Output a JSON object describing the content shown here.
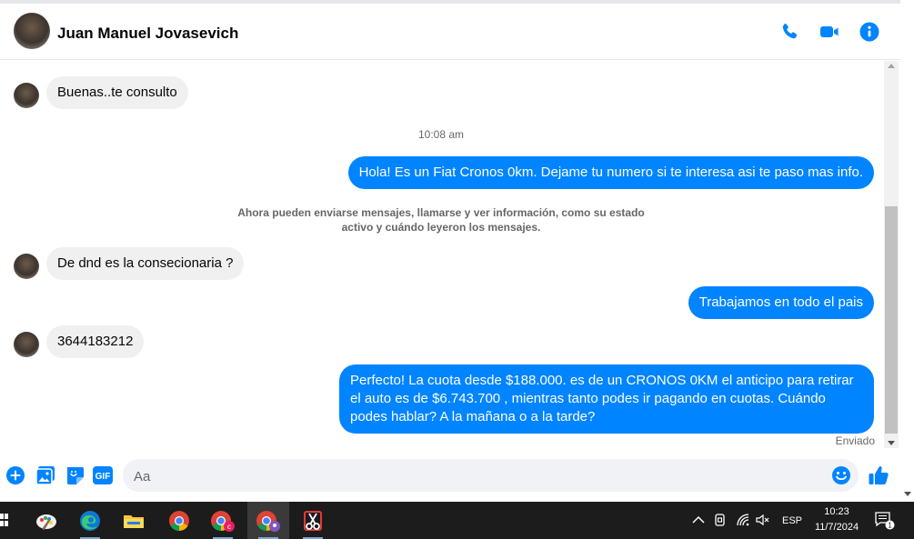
{
  "header": {
    "contact_name": "Juan Manuel Jovasevich",
    "icons": [
      "phone-icon",
      "video-call-icon",
      "info-icon"
    ]
  },
  "messages": [
    {
      "direction": "in",
      "text": "Buenas..te consulto"
    },
    {
      "type": "timestamp",
      "text": "10:08 am"
    },
    {
      "direction": "out",
      "text": "Hola! Es un Fiat Cronos 0km. Dejame tu numero si te interesa asi te paso mas info."
    },
    {
      "type": "system",
      "line1": "Ahora pueden enviarse mensajes, llamarse y ver información, como su estado",
      "line2": "activo y cuándo leyeron los mensajes."
    },
    {
      "direction": "in",
      "text": "De dnd es la consecionaria ?"
    },
    {
      "direction": "out",
      "text": "Trabajamos en todo el pais"
    },
    {
      "direction": "in",
      "text": "3644183212"
    },
    {
      "direction": "out",
      "text": "Perfecto! La cuota desde $188.000. es de un CRONOS 0KM el anticipo para retirar el auto es de $6.743.700 , mientras tanto podes ir pagando en cuotas. Cuándo podes hablar? A la mañana o a la tarde?"
    }
  ],
  "sent_status": "Enviado",
  "composer": {
    "placeholder": "Aa",
    "gif_label": "GIF",
    "icons": [
      "plus-icon",
      "photo-icon",
      "sticker-icon",
      "gif-icon",
      "emoji-icon",
      "like-icon"
    ]
  },
  "colors": {
    "accent": "#0084ff",
    "incoming_bubble": "#f0f0f0",
    "taskbar": "#1c1c1c"
  },
  "taskbar": {
    "apps": [
      "paint-icon",
      "edge-icon",
      "file-explorer-icon",
      "chrome-icon",
      "chrome-profile-c-icon",
      "chrome-profile-active-icon",
      "snipping-tool-icon"
    ],
    "language": "ESP",
    "time": "10:23",
    "date": "11/7/2024",
    "notification_count": "1"
  }
}
